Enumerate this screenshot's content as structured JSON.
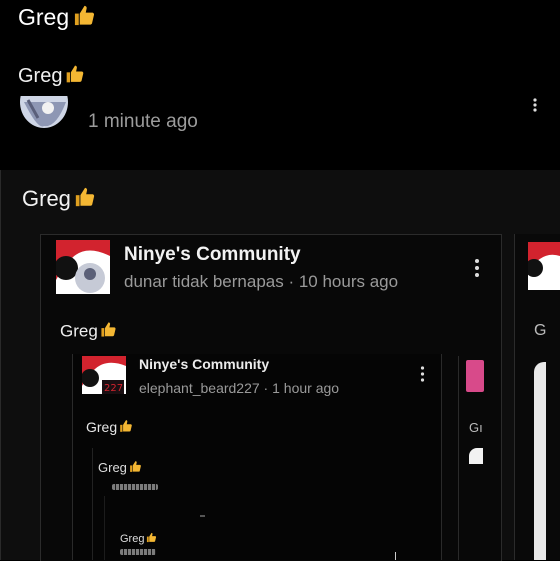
{
  "top_caption": "Greg",
  "second_caption": "Greg",
  "row1": {
    "time": "1 minute ago"
  },
  "post1": {
    "caption": "Greg",
    "card": {
      "title": "Ninye's Community",
      "meta": "dunar tidak bernapas · 10 hours ago",
      "caption": "Greg"
    },
    "side_text": "G"
  },
  "post2": {
    "card": {
      "title": "Ninye's Community",
      "meta": "elephant_beard227 · 1 hour ago",
      "caption": "Greg"
    },
    "side_text": "Gı"
  },
  "post3": {
    "caption": "Greg"
  },
  "post5": {
    "caption": "Greg"
  },
  "icons": {
    "thumb": "thumbs-up-icon",
    "more": "more-vertical-icon",
    "logo": "community-logo-icon"
  },
  "colors": {
    "background": "#000000",
    "meta_text": "#9a9a9a",
    "thumb": "#f4b733",
    "logo_red": "#d2232e"
  }
}
